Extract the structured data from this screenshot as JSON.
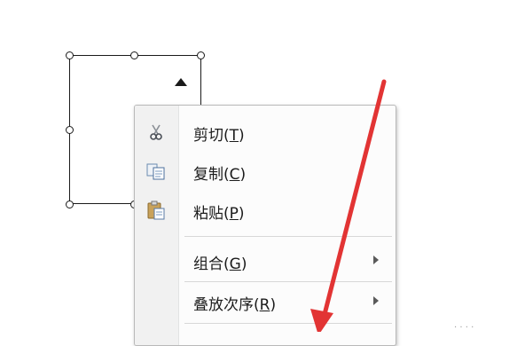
{
  "menu": {
    "items": [
      {
        "text": "剪切",
        "paren_open": "(",
        "mnemonic": "T",
        "paren_close": ")",
        "icon": "scissors-icon",
        "submenu": false
      },
      {
        "text": "复制",
        "paren_open": "(",
        "mnemonic": "C",
        "paren_close": ")",
        "icon": "copy-icon",
        "submenu": false
      },
      {
        "text": "粘贴",
        "paren_open": "(",
        "mnemonic": "P",
        "paren_close": ")",
        "icon": "paste-icon",
        "submenu": false
      },
      {
        "text": "组合",
        "paren_open": "(",
        "mnemonic": "G",
        "paren_close": ")",
        "icon": "",
        "submenu": true
      },
      {
        "text": "叠放次序",
        "paren_open": "(",
        "mnemonic": "R",
        "paren_close": ")",
        "icon": "",
        "submenu": true
      }
    ]
  },
  "colors": {
    "annotation_arrow": "#e23434",
    "menu_gutter": "#f1f1f1",
    "shape_border": "#1a1a1a"
  },
  "watermark": {
    "text": "· · · ·"
  }
}
